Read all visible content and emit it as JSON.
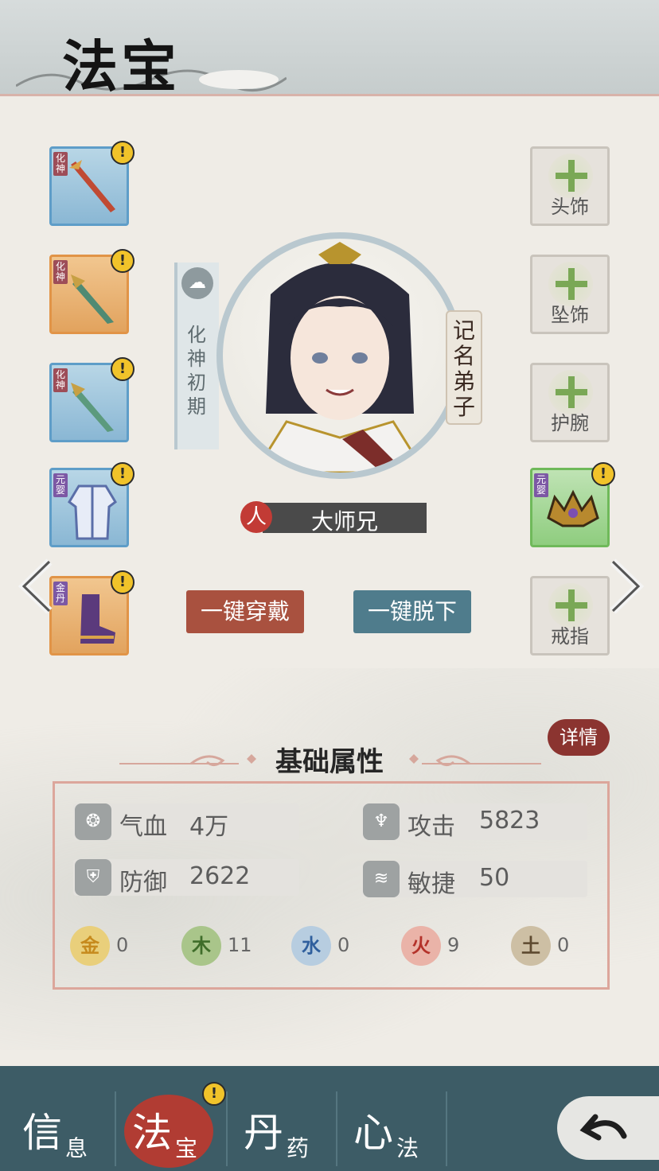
{
  "header": {
    "title": "法宝"
  },
  "portrait": {
    "realm": "化神初期",
    "rank": "记名弟子",
    "name": "大师兄",
    "seal_char": "人"
  },
  "left_slots": [
    {
      "grade": "化神",
      "item": "sword-icon",
      "color": "blue",
      "alert": "!"
    },
    {
      "grade": "化神",
      "item": "dagger-icon",
      "color": "orange",
      "alert": "!"
    },
    {
      "grade": "化神",
      "item": "dagger-icon",
      "color": "blue",
      "alert": "!"
    },
    {
      "grade": "元婴",
      "item": "robe-icon",
      "color": "blue",
      "alert": "!"
    },
    {
      "grade": "金丹",
      "item": "boot-icon",
      "color": "orange",
      "alert": "!"
    }
  ],
  "right_slots": [
    {
      "label": "头饰"
    },
    {
      "label": "坠饰"
    },
    {
      "label": "护腕"
    },
    {
      "grade": "元婴",
      "item": "crown-icon",
      "color": "green",
      "alert": "!"
    },
    {
      "label": "戒指"
    }
  ],
  "actions": {
    "equip_all": "一键穿戴",
    "unequip_all": "一键脱下"
  },
  "attributes": {
    "section_title": "基础属性",
    "detail_button": "详情",
    "stats": [
      {
        "label": "气血",
        "value": "4万"
      },
      {
        "label": "攻击",
        "value": "5823"
      },
      {
        "label": "防御",
        "value": "2622"
      },
      {
        "label": "敏捷",
        "value": "50"
      }
    ],
    "elements": [
      {
        "name": "金",
        "value": "0",
        "color": "#e9cf7b",
        "text_color": "#c68a1d"
      },
      {
        "name": "木",
        "value": "11",
        "color": "#a9c58a",
        "text_color": "#3f6d2a"
      },
      {
        "name": "水",
        "value": "0",
        "color": "#b7cde0",
        "text_color": "#2f5f9d"
      },
      {
        "name": "火",
        "value": "9",
        "color": "#eab3a8",
        "text_color": "#b4322a"
      },
      {
        "name": "土",
        "value": "0",
        "color": "#cdbfa4",
        "text_color": "#5e4a30"
      }
    ]
  },
  "nav": {
    "tabs": [
      {
        "big": "信",
        "small": "息"
      },
      {
        "big": "法",
        "small": "宝",
        "alert": "!"
      },
      {
        "big": "丹",
        "small": "药"
      },
      {
        "big": "心",
        "small": "法"
      }
    ],
    "back_icon": "back-arrow-icon"
  },
  "colors": {
    "accent_red": "#a9513f",
    "accent_teal": "#4f7c8c",
    "nav_bg": "#3d5c66"
  }
}
